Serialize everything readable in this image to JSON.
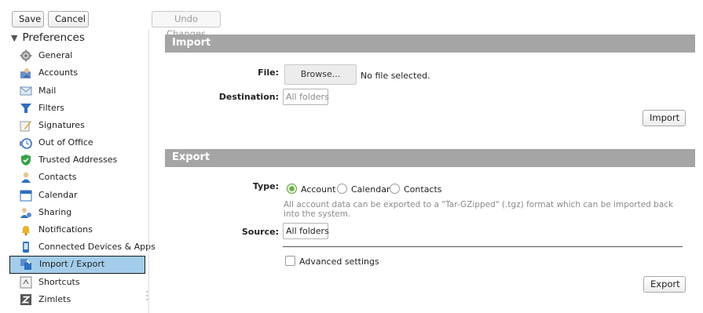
{
  "toolbar": {
    "save_label": "Save",
    "cancel_label": "Cancel",
    "undo_label": "Undo Changes"
  },
  "sidebar": {
    "header": "Preferences",
    "items": [
      {
        "label": "General",
        "icon": "gear-icon"
      },
      {
        "label": "Accounts",
        "icon": "accounts-icon"
      },
      {
        "label": "Mail",
        "icon": "mail-icon"
      },
      {
        "label": "Filters",
        "icon": "filter-icon"
      },
      {
        "label": "Signatures",
        "icon": "signature-icon"
      },
      {
        "label": "Out of Office",
        "icon": "clock-icon"
      },
      {
        "label": "Trusted Addresses",
        "icon": "shield-icon"
      },
      {
        "label": "Contacts",
        "icon": "contacts-icon"
      },
      {
        "label": "Calendar",
        "icon": "calendar-icon"
      },
      {
        "label": "Sharing",
        "icon": "sharing-icon"
      },
      {
        "label": "Notifications",
        "icon": "bell-icon"
      },
      {
        "label": "Connected Devices & Apps",
        "icon": "mobile-device-icon"
      },
      {
        "label": "Import / Export",
        "icon": "import-export-icon",
        "selected": true
      },
      {
        "label": "Shortcuts",
        "icon": "shortcuts-icon"
      },
      {
        "label": "Zimlets",
        "icon": "zimlets-icon"
      }
    ]
  },
  "import": {
    "title": "Import",
    "file_label": "File:",
    "browse_label": "Browse...",
    "no_file_text": "No file selected.",
    "destination_label": "Destination:",
    "destination_value": "All folders",
    "import_button": "Import"
  },
  "export": {
    "title": "Export",
    "type_label": "Type:",
    "type_options": [
      "Account",
      "Calendar",
      "Contacts"
    ],
    "selected_type": "Account",
    "hint": "All account data can be exported to a \"Tar-GZipped\" (.tgz) format which can be imported back into the system.",
    "source_label": "Source:",
    "source_value": "All folders",
    "advanced_label": "Advanced settings",
    "export_button": "Export"
  },
  "colors": {
    "section_bar": "#a5a5a5",
    "selected_item": "#a3cdea",
    "radio_selected": "#6cae43"
  }
}
